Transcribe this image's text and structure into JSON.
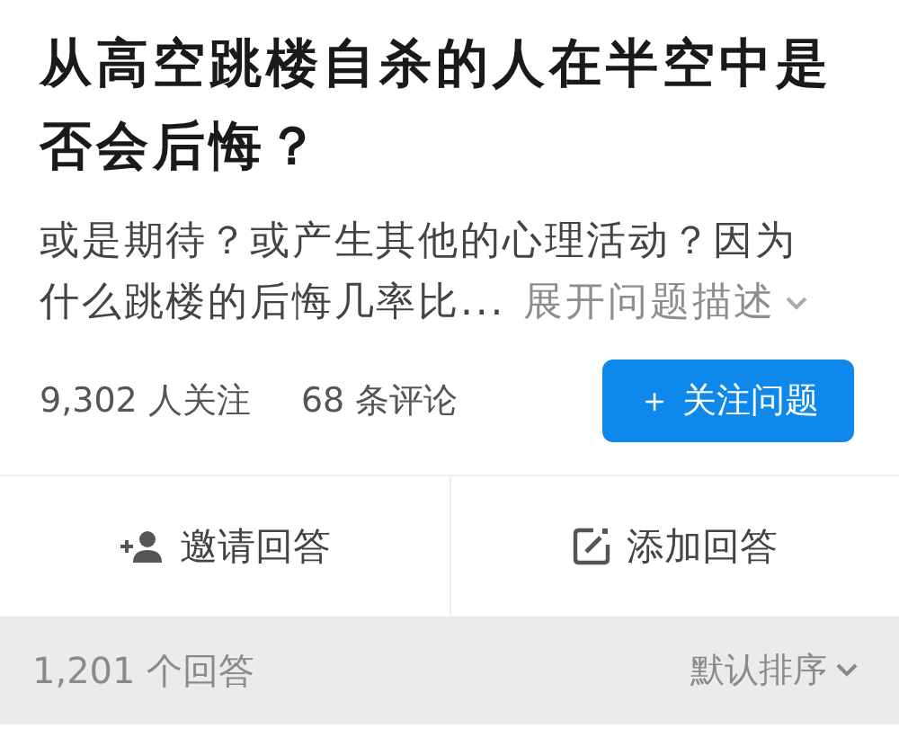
{
  "question": {
    "title": "从高空跳楼自杀的人在半空中是否会后悔？",
    "description": "或是期待？或产生其他的心理活动？因为什么跳楼的后悔几率比...",
    "expand_link": "展开问题描述"
  },
  "stats": {
    "followers": "9,302 人关注",
    "comments": "68 条评论"
  },
  "follow_button": {
    "icon": "＋",
    "label": "关注问题"
  },
  "actions": [
    {
      "kind": "invite",
      "label": "邀请回答"
    },
    {
      "kind": "write",
      "label": "添加回答"
    }
  ],
  "answers_bar": {
    "count": "1,201 个回答",
    "sort": "默认排序"
  }
}
